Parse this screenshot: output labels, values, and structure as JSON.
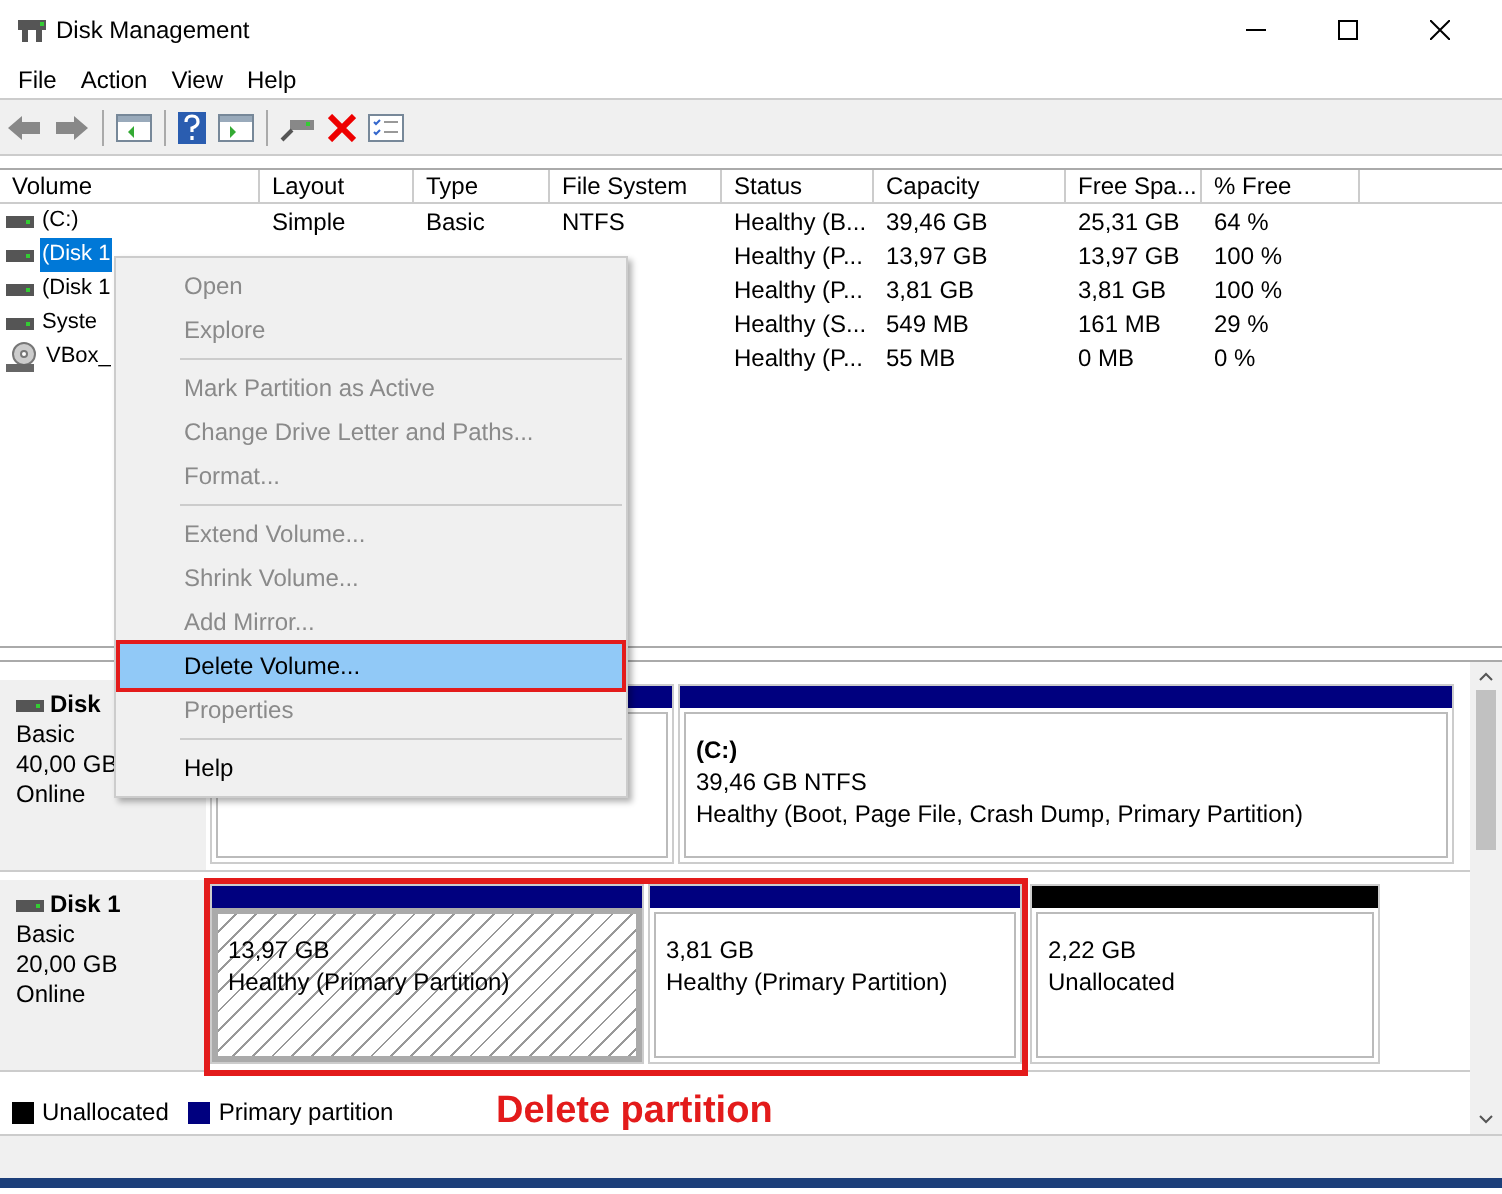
{
  "window": {
    "title": "Disk Management"
  },
  "menu_bar": [
    "File",
    "Action",
    "View",
    "Help"
  ],
  "volume_table": {
    "columns": [
      "Volume",
      "Layout",
      "Type",
      "File System",
      "Status",
      "Capacity",
      "Free Spa...",
      "% Free"
    ],
    "rows": [
      {
        "kind": "disk",
        "selected": false,
        "cells": [
          "(C:)",
          "Simple",
          "Basic",
          "NTFS",
          "Healthy (B...",
          "39,46 GB",
          "25,31 GB",
          "64 %"
        ]
      },
      {
        "kind": "disk",
        "selected": true,
        "cells": [
          "(Disk 1",
          "",
          "",
          "",
          "Healthy (P...",
          "13,97 GB",
          "13,97 GB",
          "100 %"
        ]
      },
      {
        "kind": "disk",
        "selected": false,
        "cells": [
          "(Disk 1",
          "",
          "",
          "",
          "Healthy (P...",
          "3,81 GB",
          "3,81 GB",
          "100 %"
        ]
      },
      {
        "kind": "disk",
        "selected": false,
        "cells": [
          "Syste",
          "",
          "",
          "",
          "Healthy (S...",
          "549 MB",
          "161 MB",
          "29 %"
        ]
      },
      {
        "kind": "cd",
        "selected": false,
        "cells": [
          "VBox_",
          "",
          "",
          "",
          "Healthy (P...",
          "55 MB",
          "0 MB",
          "0 %"
        ]
      }
    ]
  },
  "context_menu": [
    {
      "label": "Open",
      "disabled": true,
      "selected": false,
      "separator_after": false
    },
    {
      "label": "Explore",
      "disabled": true,
      "selected": false,
      "separator_after": true
    },
    {
      "label": "Mark Partition as Active",
      "disabled": true,
      "selected": false,
      "separator_after": false
    },
    {
      "label": "Change Drive Letter and Paths...",
      "disabled": true,
      "selected": false,
      "separator_after": false
    },
    {
      "label": "Format...",
      "disabled": true,
      "selected": false,
      "separator_after": true
    },
    {
      "label": "Extend Volume...",
      "disabled": true,
      "selected": false,
      "separator_after": false
    },
    {
      "label": "Shrink Volume...",
      "disabled": true,
      "selected": false,
      "separator_after": false
    },
    {
      "label": "Add Mirror...",
      "disabled": true,
      "selected": false,
      "separator_after": false
    },
    {
      "label": "Delete Volume...",
      "disabled": false,
      "selected": true,
      "separator_after": false
    },
    {
      "label": "Properties",
      "disabled": true,
      "selected": false,
      "separator_after": true
    },
    {
      "label": "Help",
      "disabled": false,
      "selected": false,
      "separator_after": false
    }
  ],
  "disks": [
    {
      "name": "Disk",
      "type": "Basic",
      "size": "40,00 GB",
      "status": "Online",
      "partitions": [
        {
          "kind": "primary",
          "selected": false
        },
        {
          "kind": "primary",
          "selected": false,
          "texts": [
            "(C:)",
            "39,46 GB NTFS",
            "Healthy (Boot, Page File, Crash Dump, Primary Partition)"
          ]
        }
      ]
    },
    {
      "name": "Disk 1",
      "type": "Basic",
      "size": "20,00 GB",
      "status": "Online",
      "partitions": [
        {
          "kind": "primary",
          "selected": true,
          "highlighted": true,
          "texts": [
            "13,97 GB",
            "Healthy (Primary Partition)"
          ]
        },
        {
          "kind": "primary",
          "selected": false,
          "highlighted": true,
          "texts": [
            "3,81 GB",
            "Healthy (Primary Partition)"
          ]
        },
        {
          "kind": "unallocated",
          "selected": false,
          "highlighted": false,
          "texts": [
            "2,22 GB",
            "Unallocated"
          ]
        }
      ]
    }
  ],
  "legend": [
    {
      "label": "Unallocated",
      "color": "#000000"
    },
    {
      "label": "Primary partition",
      "color": "#00007f"
    }
  ],
  "annotation": {
    "label": "Delete partition"
  }
}
